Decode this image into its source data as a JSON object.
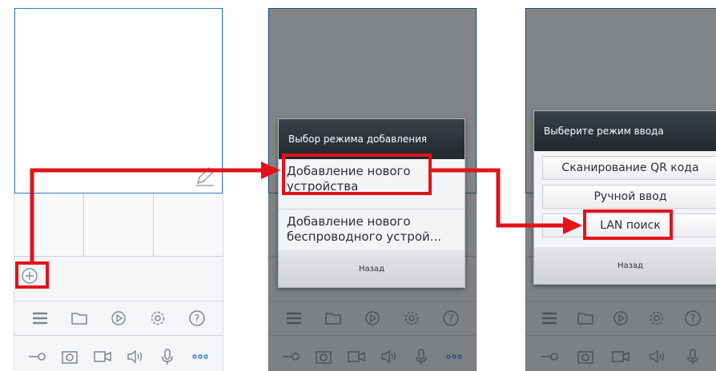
{
  "panel2": {
    "dialog_title": "Выбор режима добавления",
    "option_add_device": "Добавление нового устройства",
    "option_add_wireless": "Добавление нового беспроводного устрой...",
    "back_label": "Назад"
  },
  "panel3": {
    "dialog_title": "Выберите режим ввода",
    "option_qr": "Сканирование QR кода",
    "option_manual": "Ручной ввод",
    "option_lan": "LAN поиск",
    "back_label": "Назад"
  },
  "toolbar1_icons": [
    "list-icon",
    "folder-icon",
    "playback-icon",
    "settings-icon",
    "help-icon"
  ],
  "toolbar2_icons": [
    "key-icon",
    "snapshot-icon",
    "record-icon",
    "speaker-icon",
    "microphone-icon",
    "more-icon"
  ],
  "colors": {
    "accent": "#2a7fc1",
    "highlight": "#e3121a",
    "dialog_header": "#2a2f36"
  }
}
